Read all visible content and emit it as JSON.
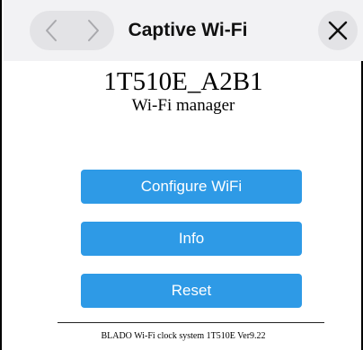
{
  "header": {
    "title": "Captive Wi-Fi",
    "back_icon": "chevron-left-icon",
    "forward_icon": "chevron-right-icon",
    "close_icon": "close-icon"
  },
  "main": {
    "device_name": "1T510E_A2B1",
    "subtitle": "Wi-Fi manager",
    "buttons": {
      "configure": "Configure WiFi",
      "info": "Info",
      "reset": "Reset"
    }
  },
  "footer": {
    "text": "BLADO Wi-Fi clock system 1T510E Ver9.22"
  },
  "colors": {
    "button_bg": "#2e9ae6",
    "toolbar_bg": "#f2f2f4",
    "control_bg": "#e3e3e6"
  }
}
